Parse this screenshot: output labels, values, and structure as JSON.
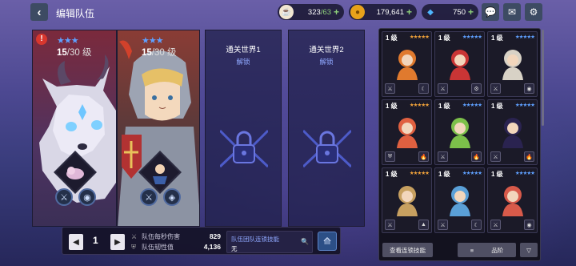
{
  "header": {
    "title": "编辑队伍"
  },
  "resources": [
    {
      "name": "coffee",
      "value": "323",
      "max": "/63",
      "icon": "coffee-icon"
    },
    {
      "name": "gold",
      "value": "179,641",
      "icon": "gold-coin-icon"
    },
    {
      "name": "gem",
      "value": "750",
      "icon": "gem-icon"
    }
  ],
  "top_buttons": [
    "chat-icon",
    "mail-icon",
    "settings-icon"
  ],
  "slots": [
    {
      "level": "15",
      "max": "/30",
      "unit": "级",
      "stars": "★★★",
      "stars_dim": "★★★★"
    },
    {
      "level": "15",
      "max": "/30",
      "unit": "级",
      "stars": "★★★",
      "stars_dim": "★★★★"
    },
    {
      "unlock_title": "通关世界1",
      "unlock_label": "解锁"
    },
    {
      "unlock_title": "通关世界2",
      "unlock_label": "解锁"
    }
  ],
  "bottom": {
    "page": "1",
    "dps_label": "队伍每秒伤害",
    "dps_value": "829",
    "hp_label": "队伍韧性值",
    "hp_value": "4,136",
    "link_label": "队伍团队连锁技能",
    "link_value": "无"
  },
  "roster": [
    {
      "level": "1 级",
      "color": "#e07a2e",
      "stars": "★★★★★"
    },
    {
      "level": "1 级",
      "color": "#c93535",
      "stars": "★★★★★"
    },
    {
      "level": "1 级",
      "color": "#d8d2c6",
      "stars": "★★★★★"
    },
    {
      "level": "1 级",
      "color": "#e06040",
      "stars": "★★★★★"
    },
    {
      "level": "1 级",
      "color": "#7cc04a",
      "stars": "★★★★★"
    },
    {
      "level": "1 级",
      "color": "#2a2350",
      "stars": "★★★★★"
    },
    {
      "level": "1 级",
      "color": "#c7a060",
      "stars": "★★★★★"
    },
    {
      "level": "1 级",
      "color": "#5aa0d8",
      "stars": "★★★★★"
    },
    {
      "level": "1 级",
      "color": "#d85a4a",
      "stars": "★★★★★"
    }
  ],
  "panel_buttons": {
    "chain": "查看连锁技能",
    "sort": "品阶"
  }
}
